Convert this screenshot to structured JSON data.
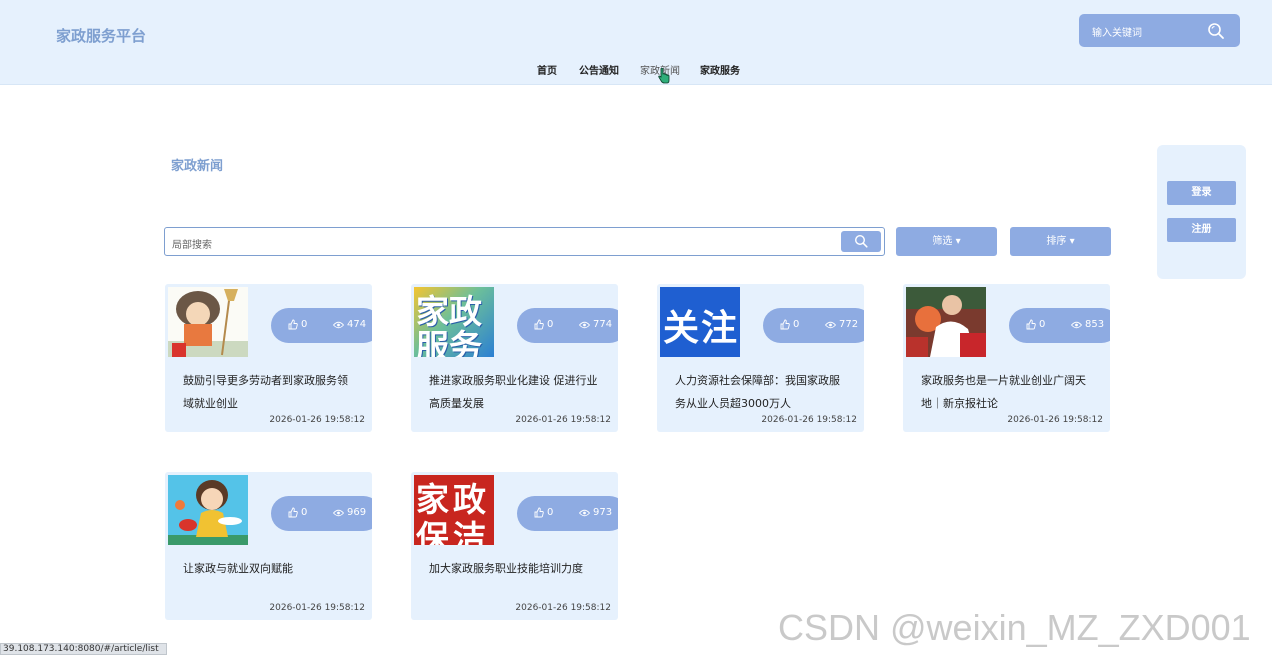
{
  "header": {
    "brand": "家政服务平台",
    "search_placeholder": "输入关键词",
    "nav": [
      {
        "label": "首页"
      },
      {
        "label": "公告通知"
      },
      {
        "label": "家政新闻"
      },
      {
        "label": "家政服务"
      }
    ]
  },
  "section_title": "家政新闻",
  "filter_bar": {
    "search_placeholder": "局部搜索",
    "filter_label": "筛选 ▾",
    "sort_label": "排序 ▾"
  },
  "side_panel": {
    "login_label": "登录",
    "register_label": "注册"
  },
  "articles": [
    {
      "title": "鼓励引导更多劳动者到家政服务领域就业创业",
      "likes": "0",
      "views": "474",
      "time": "2026-01-26 19:58:12"
    },
    {
      "title": "推进家政服务职业化建设 促进行业高质量发展",
      "likes": "0",
      "views": "774",
      "time": "2026-01-26 19:58:12",
      "thumb_text": [
        "家政",
        "服务"
      ]
    },
    {
      "title": "人力资源社会保障部：我国家政服务从业人员超3000万人",
      "likes": "0",
      "views": "772",
      "time": "2026-01-26 19:58:12",
      "thumb_text": [
        "关注"
      ]
    },
    {
      "title": "家政服务也是一片就业创业广阔天地｜新京报社论",
      "likes": "0",
      "views": "853",
      "time": "2026-01-26 19:58:12"
    },
    {
      "title": "让家政与就业双向赋能",
      "likes": "0",
      "views": "969",
      "time": "2026-01-26 19:58:12"
    },
    {
      "title": "加大家政服务职业技能培训力度",
      "likes": "0",
      "views": "973",
      "time": "2026-01-26 19:58:12",
      "thumb_text": [
        "家政",
        "保洁"
      ]
    }
  ],
  "watermark": "CSDN @weixin_MZ_ZXD001",
  "status_url": "39.108.173.140:8080/#/article/list",
  "colors": {
    "accent": "#8eabe2",
    "header_bg": "#e6f1fd",
    "brand": "#7e9fd0"
  }
}
